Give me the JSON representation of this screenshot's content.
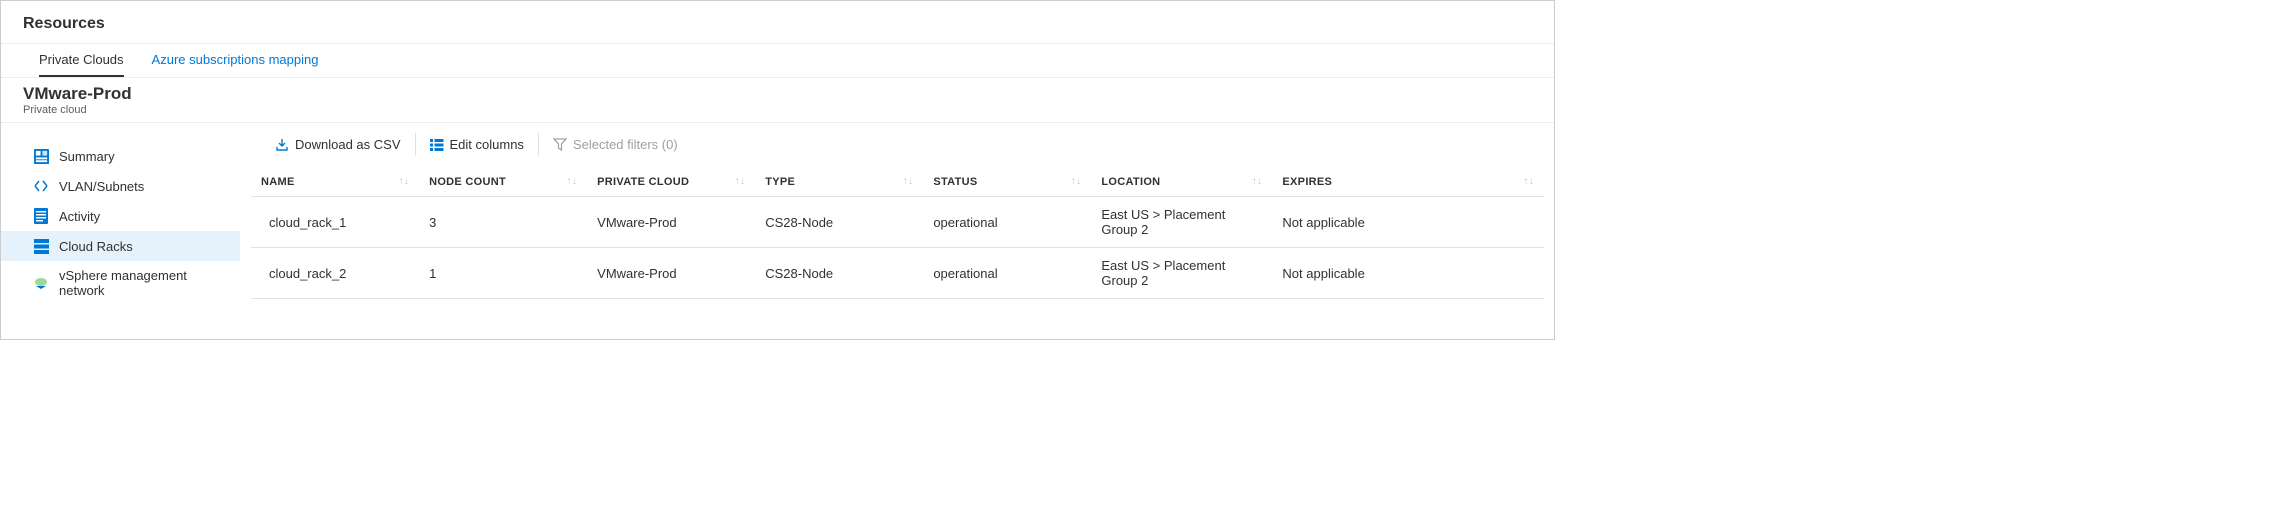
{
  "header": {
    "title": "Resources"
  },
  "tabs": {
    "private_clouds": "Private Clouds",
    "azure_mapping": "Azure subscriptions mapping"
  },
  "title_block": {
    "name": "VMware-Prod",
    "subtitle": "Private cloud"
  },
  "sidebar": {
    "items": [
      {
        "label": "Summary"
      },
      {
        "label": "VLAN/Subnets"
      },
      {
        "label": "Activity"
      },
      {
        "label": "Cloud Racks"
      },
      {
        "label": "vSphere management network"
      }
    ]
  },
  "toolbar": {
    "download_csv": "Download as CSV",
    "edit_columns": "Edit columns",
    "selected_filters": "Selected filters (0)"
  },
  "table": {
    "columns": {
      "name": "NAME",
      "node_count": "NODE COUNT",
      "private_cloud": "PRIVATE CLOUD",
      "type": "TYPE",
      "status": "STATUS",
      "location": "LOCATION",
      "expires": "EXPIRES"
    },
    "rows": [
      {
        "name": "cloud_rack_1",
        "node_count": "3",
        "private_cloud": "VMware-Prod",
        "type": "CS28-Node",
        "status": "operational",
        "location": "East US > Placement Group 2",
        "expires": "Not applicable"
      },
      {
        "name": "cloud_rack_2",
        "node_count": "1",
        "private_cloud": "VMware-Prod",
        "type": "CS28-Node",
        "status": "operational",
        "location": "East US > Placement Group 2",
        "expires": "Not applicable"
      }
    ]
  }
}
